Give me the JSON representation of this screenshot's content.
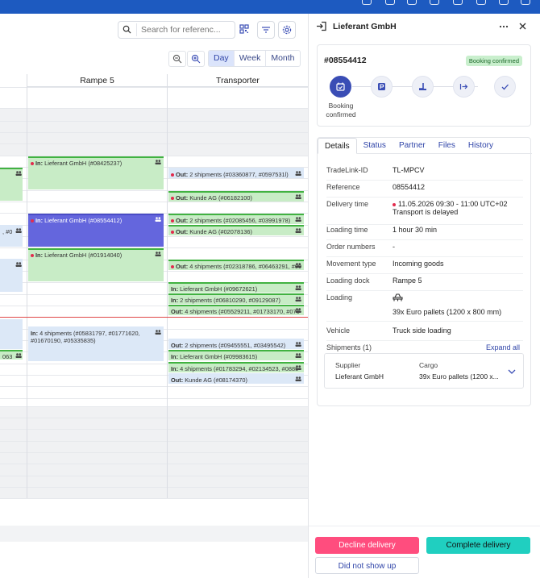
{
  "toolbar": {
    "search_placeholder": "Search for referenc...",
    "view_modes": [
      "Day",
      "Week",
      "Month"
    ],
    "active_view": "Day"
  },
  "calendar": {
    "columns": [
      "Rampe 5",
      "Transporter"
    ],
    "bookings": [
      {
        "lane": "rampe5",
        "direction": "In:",
        "text": "Lieferant GmbH (#08425237)",
        "style": "green"
      },
      {
        "lane": "rampe5",
        "direction": "In:",
        "text": "Lieferant GmbH (#08554412)",
        "style": "purple"
      },
      {
        "lane": "rampe5",
        "direction": "In:",
        "text": "Lieferant GmbH (#01914040)",
        "style": "green"
      },
      {
        "lane": "rampe5",
        "direction": "In:",
        "text": "4 shipments (#05831797, #01771620, #01670190, #05335835)",
        "style": "blue"
      },
      {
        "lane": "transporter",
        "direction": "Out:",
        "text": "2 shipments (#03360877, #0597531l)",
        "style": "blue"
      },
      {
        "lane": "transporter",
        "direction": "Out:",
        "text": "Kunde AG (#06182100)",
        "style": "green"
      },
      {
        "lane": "transporter",
        "direction": "Out:",
        "text": "2 shipments (#02085456, #03991978)",
        "style": "green"
      },
      {
        "lane": "transporter",
        "direction": "Out:",
        "text": "Kunde AG (#02078136)",
        "style": "green"
      },
      {
        "lane": "transporter",
        "direction": "Out:",
        "text": "4 shipments (#02318786, #06463291, #09",
        "style": "green"
      },
      {
        "lane": "transporter",
        "direction": "In:",
        "text": "Lieferant GmbH (#09672621)",
        "style": "green"
      },
      {
        "lane": "transporter",
        "direction": "In:",
        "text": "2 shipments (#06810290, #09129087)",
        "style": "green"
      },
      {
        "lane": "transporter",
        "direction": "Out:",
        "text": "4 shipments (#05529211, #01733170, #070",
        "style": "green"
      },
      {
        "lane": "transporter",
        "direction": "Out:",
        "text": "2 shipments (#09455551, #03495542)",
        "style": "blue"
      },
      {
        "lane": "transporter",
        "direction": "In:",
        "text": "Lieferant GmbH (#09983615)",
        "style": "green"
      },
      {
        "lane": "transporter",
        "direction": "In:",
        "text": "4 shipments (#01783294, #02134523, #0885",
        "style": "green"
      },
      {
        "lane": "transporter",
        "direction": "Out:",
        "text": "Kunde AG (#08174370)",
        "style": "blue"
      },
      {
        "lane": "left",
        "text": ", #0",
        "style": "blue"
      },
      {
        "lane": "left",
        "text": "063",
        "style": "green"
      }
    ]
  },
  "panel": {
    "title": "Lieferant GmbH",
    "reference": "#08554412",
    "badge": "Booking confirmed",
    "step_label": "Booking confirmed",
    "tabs": [
      "Details",
      "Status",
      "Partner",
      "Files",
      "History"
    ],
    "active_tab": "Details",
    "details": [
      {
        "key": "TradeLink-ID",
        "value": "TL-MPCV"
      },
      {
        "key": "Reference",
        "value": "08554412"
      },
      {
        "key": "Delivery time",
        "value": "11.05.2026 09:30 - 11:00 UTC+02",
        "note": "Transport is delayed"
      },
      {
        "key": "Loading time",
        "value": "1 hour 30 min"
      },
      {
        "key": "Order numbers",
        "value": "-"
      },
      {
        "key": "Movement type",
        "value": "Incoming goods"
      },
      {
        "key": "Loading dock",
        "value": "Rampe 5"
      },
      {
        "key": "Loading",
        "value": "39x Euro pallets (1200 x 800 mm)"
      },
      {
        "key": "Vehicle",
        "value": "Truck side loading"
      }
    ],
    "shipments_label": "Shipments (1)",
    "expand_all": "Expand all",
    "shipment": {
      "supplier_label": "Supplier",
      "supplier": "Lieferant GmbH",
      "cargo_label": "Cargo",
      "cargo": "39x Euro pallets (1200 x..."
    },
    "buttons": {
      "decline": "Decline delivery",
      "complete": "Complete delivery",
      "no_show": "Did not show up"
    }
  },
  "colors": {
    "brand": "#1d5ac0",
    "accent": "#2f44a8",
    "decline": "#ff4d7e",
    "complete": "#20cfc0",
    "booking_green": "#c8ecc6",
    "booking_blue": "#dce8f7",
    "booking_selected": "#6466dd"
  }
}
